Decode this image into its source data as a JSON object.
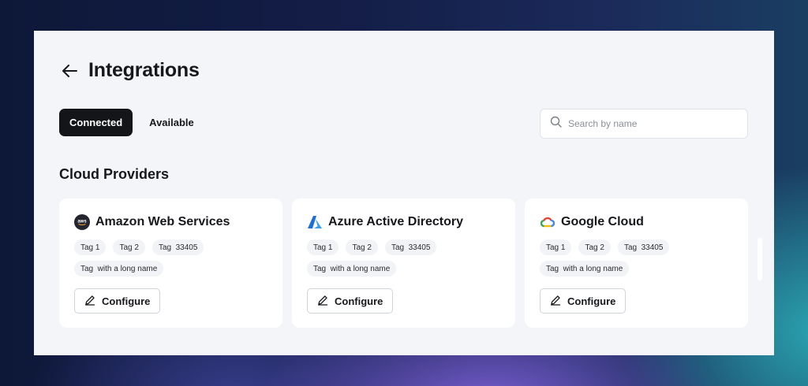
{
  "page": {
    "title": "Integrations"
  },
  "tabs": [
    {
      "label": "Connected",
      "active": true
    },
    {
      "label": "Available",
      "active": false
    }
  ],
  "search": {
    "placeholder": "Search by name",
    "value": ""
  },
  "section": {
    "title": "Cloud Providers"
  },
  "cards": [
    {
      "name": "Amazon Web Services",
      "logo": "aws-logo-icon",
      "tags": [
        "Tag 1",
        "Tag 2",
        "Tag  33405",
        "Tag  with a long name"
      ],
      "action": "Configure"
    },
    {
      "name": "Azure Active Directory",
      "logo": "azure-logo-icon",
      "tags": [
        "Tag 1",
        "Tag 2",
        "Tag  33405",
        "Tag  with a long name"
      ],
      "action": "Configure"
    },
    {
      "name": "Google Cloud",
      "logo": "google-cloud-logo-icon",
      "tags": [
        "Tag 1",
        "Tag 2",
        "Tag  33405",
        "Tag  with a long name"
      ],
      "action": "Configure"
    }
  ],
  "aws_logo_text": "aws",
  "colors": {
    "accent": "#141518",
    "panel": "#f3f5f9",
    "card": "#ffffff",
    "tag": "#f1f3f6"
  }
}
